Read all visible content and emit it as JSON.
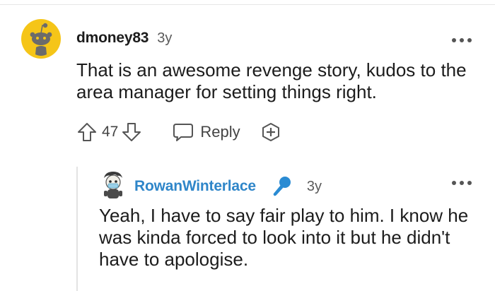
{
  "comment": {
    "author": "dmoney83",
    "age": "3y",
    "body": "That is an awesome revenge story, kudos to the area manager for setting things right.",
    "score": "47",
    "reply_label": "Reply",
    "avatar_icon": "reddit-snoo-default-avatar",
    "avatar_color": "#f5c518"
  },
  "reply": {
    "author": "RowanWinterlace",
    "age": "3y",
    "body": "Yeah, I have to say fair play to him. I know he was kinda forced to look into it but he didn't have to apologise.",
    "author_color": "#2f86c9",
    "flair_icon": "microphone-icon",
    "avatar_icon": "custom-snoo-avatar"
  },
  "icons": {
    "upvote": "arrow-up-icon",
    "downvote": "arrow-down-icon",
    "reply": "speech-bubble-icon",
    "award": "add-award-icon",
    "more": "more-options-icon"
  }
}
